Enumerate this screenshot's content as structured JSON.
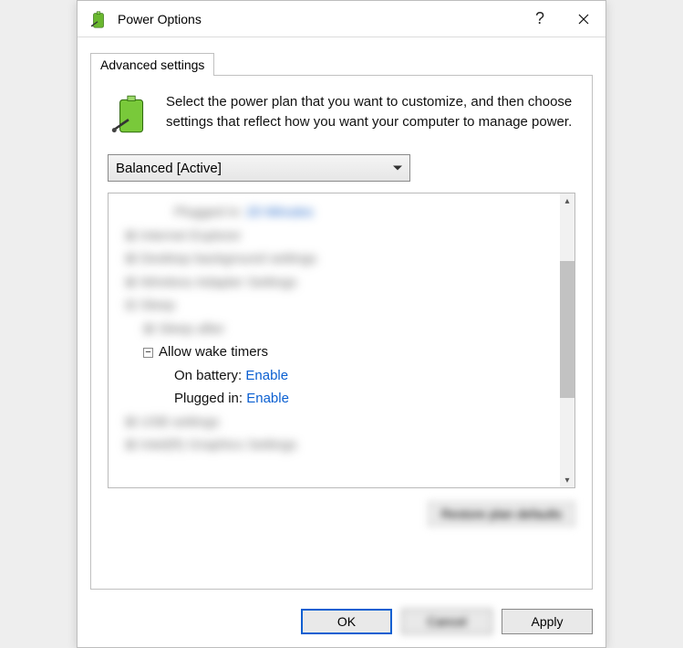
{
  "title": "Power Options",
  "tabs": {
    "advanced": "Advanced settings"
  },
  "intro_text": "Select the power plan that you want to customize, and then choose settings that reflect how you want your computer to manage power.",
  "plan_selected": "Balanced [Active]",
  "blurred": {
    "top_indented": "Plugged in:",
    "top_value": "20 Minutes",
    "row_ie": "Internet Explorer",
    "row_desktop": "Desktop background settings",
    "row_wireless": "Wireless Adapter Settings",
    "row_sleep": "Sleep",
    "row_sleep_after": "Sleep after",
    "row_usb": "USB settings",
    "row_gfx": "Intel(R) Graphics Settings"
  },
  "wake_timers": {
    "label": "Allow wake timers",
    "on_battery_label": "On battery:",
    "on_battery_value": "Enable",
    "plugged_in_label": "Plugged in:",
    "plugged_in_value": "Enable"
  },
  "restore_button": "Restore plan defaults",
  "buttons": {
    "ok": "OK",
    "cancel": "Cancel",
    "apply": "Apply"
  }
}
